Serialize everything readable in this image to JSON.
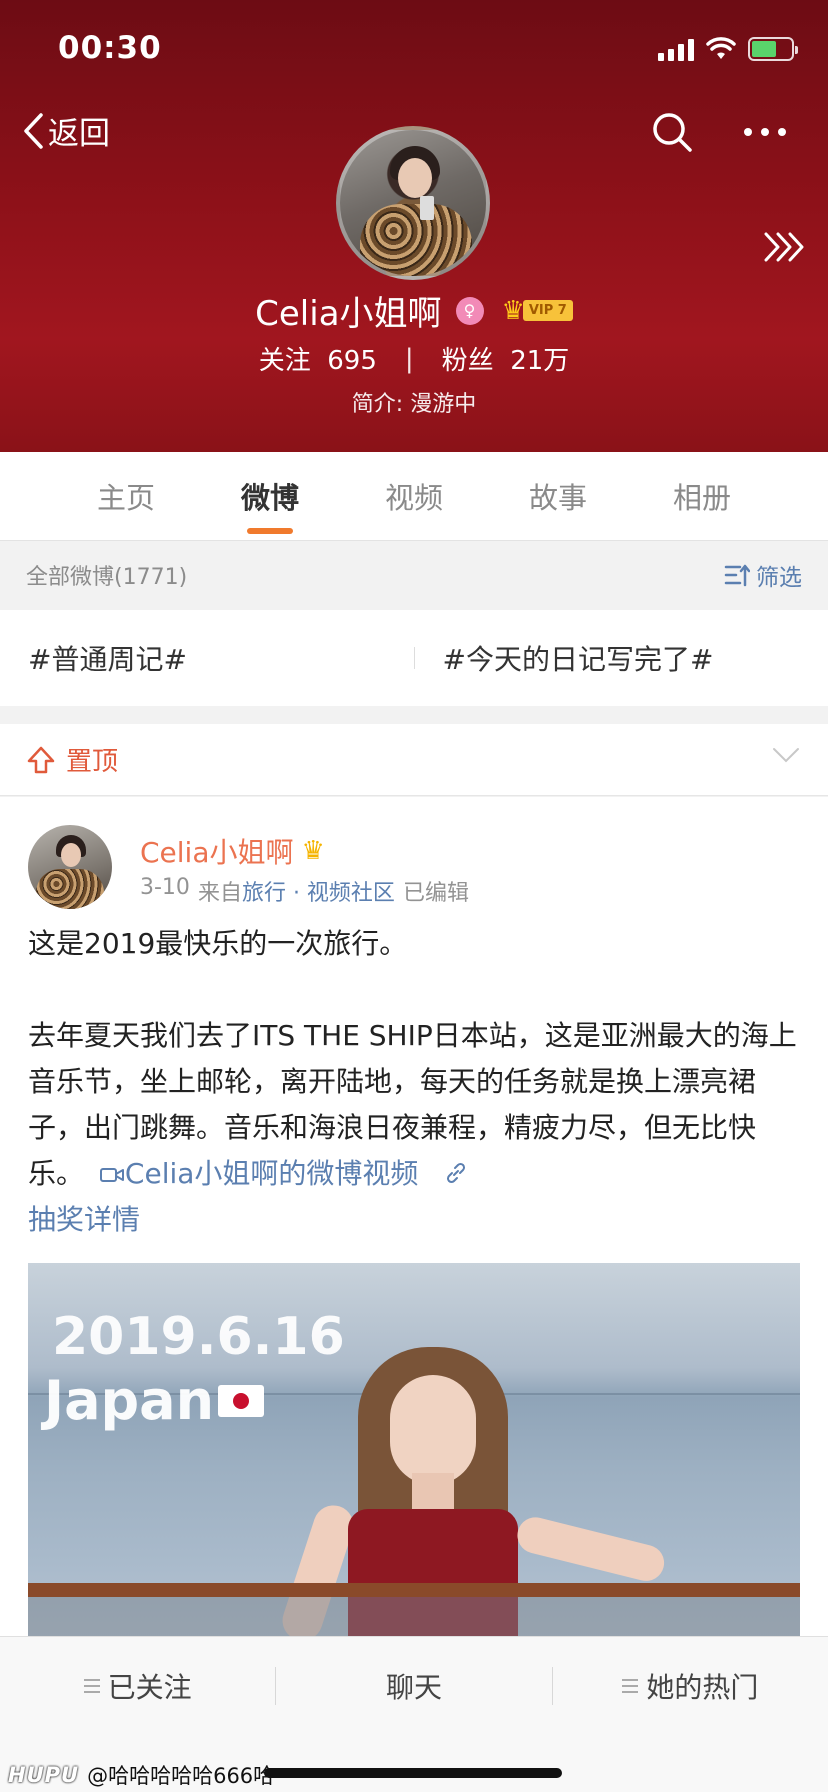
{
  "status_bar": {
    "time": "00:30"
  },
  "header": {
    "back_label": "返回",
    "name": "Celia小姐啊",
    "gender_icon": "female-icon",
    "vip_label": "VIP 7",
    "following_label": "关注",
    "following_count": "695",
    "separator": "|",
    "followers_label": "粉丝",
    "followers_count": "21万",
    "bio": "简介: 漫游中"
  },
  "tabs": [
    {
      "label": "主页",
      "active": false
    },
    {
      "label": "微博",
      "active": true
    },
    {
      "label": "视频",
      "active": false
    },
    {
      "label": "故事",
      "active": false
    },
    {
      "label": "相册",
      "active": false
    }
  ],
  "filter_bar": {
    "all_label": "全部微博(1771)",
    "filter_label": "筛选"
  },
  "topics": [
    "#普通周记#",
    "#今天的日记写完了#"
  ],
  "pinned": {
    "label": "置顶"
  },
  "post": {
    "author": "Celia小姐啊",
    "date": "3-10",
    "source_prefix": "来自",
    "source_link": "旅行 · 视频社区",
    "edited": "已编辑",
    "line1": "这是2019最快乐的一次旅行。",
    "body": "去年夏天我们去了ITS THE SHIP日本站，这是亚洲最大的海上音乐节，坐上邮轮，离开陆地，每天的任务就是换上漂亮裙子，出门跳舞。音乐和海浪日夜兼程，精疲力尽，但无比快乐。",
    "video_link": "Celia小姐啊的微博视频",
    "lottery_link": "抽奖详情",
    "video_overlay_date": "2019.6.16",
    "video_overlay_place": "Japan"
  },
  "bottom_bar": {
    "follow_label": "已关注",
    "chat_label": "聊天",
    "hot_label": "她的热门"
  },
  "watermark": {
    "brand": "HUPU",
    "user": "@哈哈哈哈哈666哈"
  },
  "colors": {
    "header_red": "#8e1119",
    "accent_orange": "#f07a2d",
    "link_blue": "#5b7fb0",
    "author_orange": "#eb7350"
  }
}
